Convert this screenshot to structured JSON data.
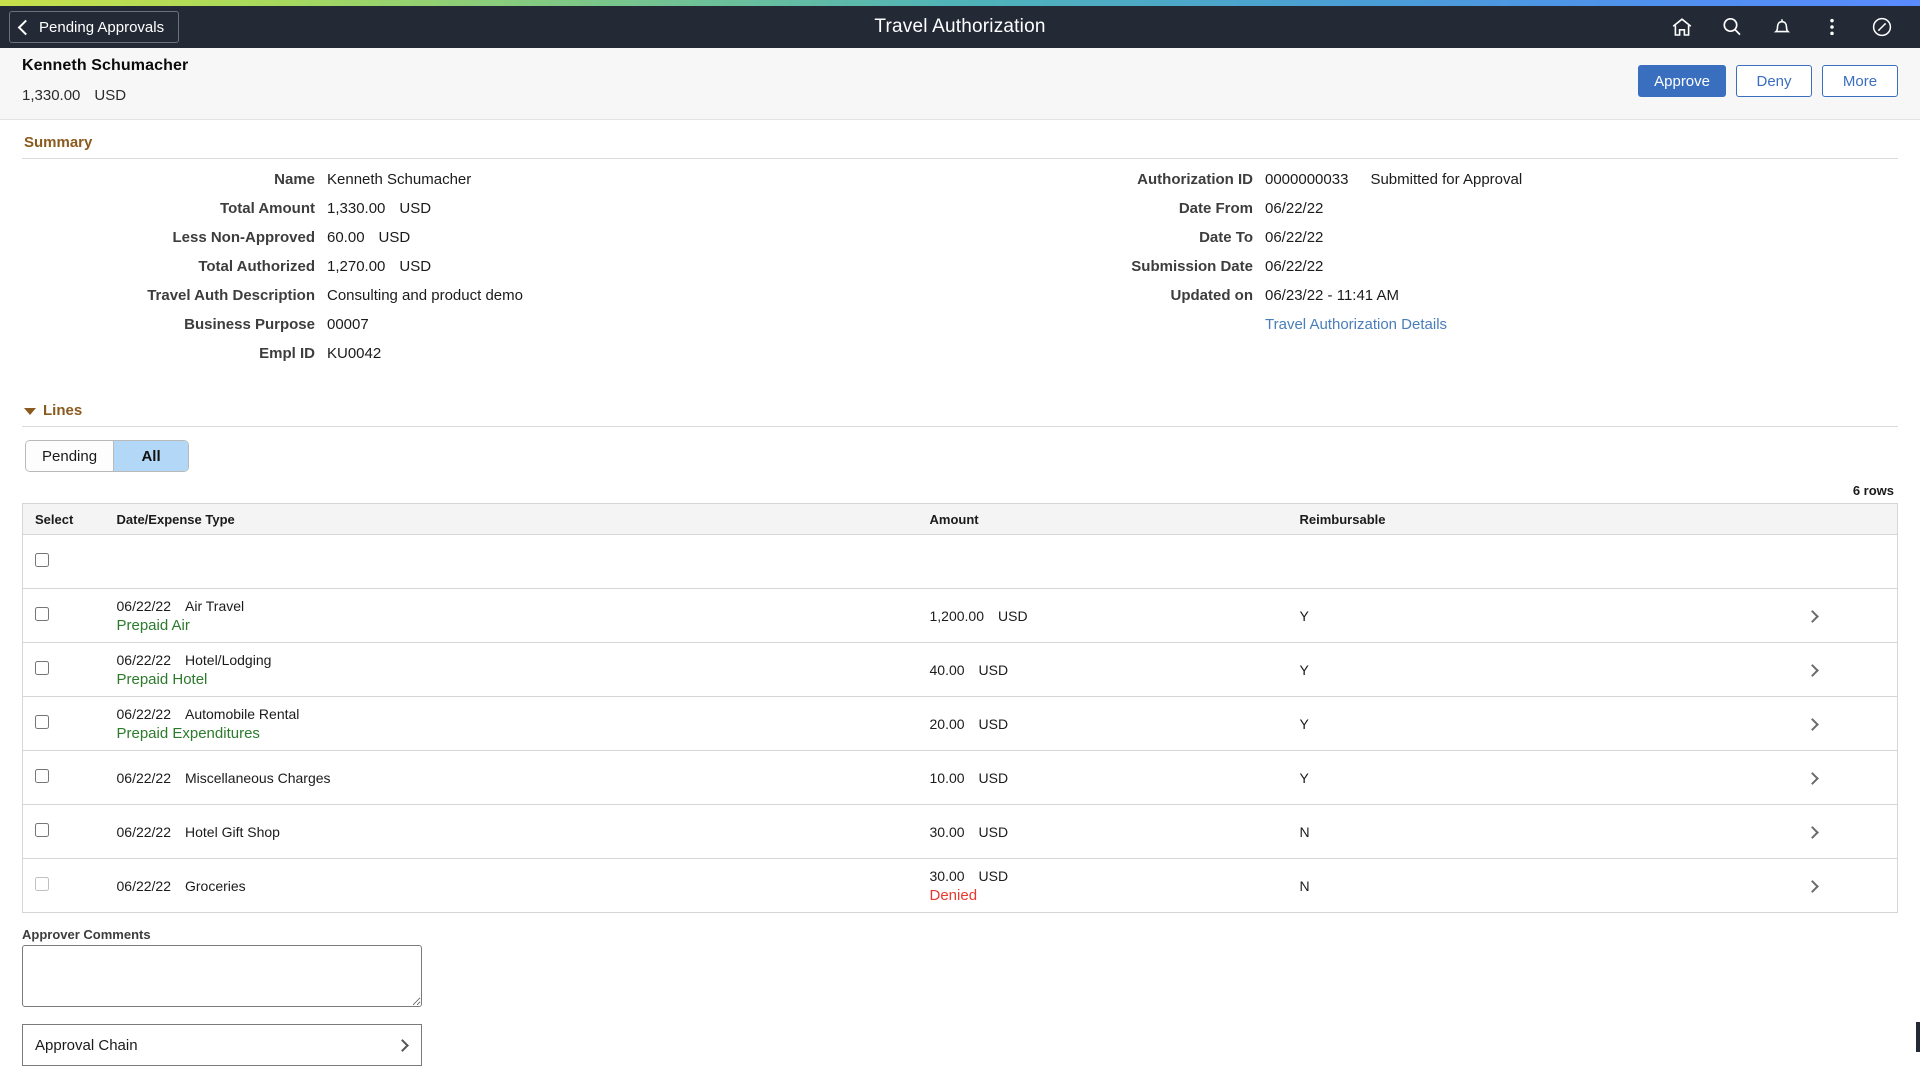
{
  "header": {
    "back_label": "Pending Approvals",
    "title": "Travel Authorization",
    "icons": [
      "home-icon",
      "search-icon",
      "notification-bell-icon",
      "overflow-menu-icon",
      "nav-bar-icon"
    ]
  },
  "subheader": {
    "employee_name": "Kenneth Schumacher",
    "amount": "1,330.00",
    "currency": "USD",
    "actions": {
      "approve": "Approve",
      "deny": "Deny",
      "more": "More"
    }
  },
  "summary": {
    "title": "Summary",
    "left": [
      {
        "label": "Name",
        "value": "Kenneth Schumacher",
        "unit": ""
      },
      {
        "label": "Total Amount",
        "value": "1,330.00",
        "unit": "USD"
      },
      {
        "label": "Less Non-Approved",
        "value": "60.00",
        "unit": "USD"
      },
      {
        "label": "Total Authorized",
        "value": "1,270.00",
        "unit": "USD"
      },
      {
        "label": "Travel Auth Description",
        "value": "Consulting and product demo",
        "unit": ""
      },
      {
        "label": "Business Purpose",
        "value": "00007",
        "unit": ""
      },
      {
        "label": "Empl ID",
        "value": "KU0042",
        "unit": ""
      }
    ],
    "right": [
      {
        "label": "Authorization ID",
        "value": "0000000033",
        "status": "Submitted for Approval"
      },
      {
        "label": "Date From",
        "value": "06/22/22",
        "status": ""
      },
      {
        "label": "Date To",
        "value": "06/22/22",
        "status": ""
      },
      {
        "label": "Submission Date",
        "value": "06/22/22",
        "status": ""
      },
      {
        "label": "Updated on",
        "value": "06/23/22 - 11:41 AM",
        "status": ""
      }
    ],
    "details_link": "Travel Authorization Details"
  },
  "lines": {
    "title": "Lines",
    "tabs": [
      {
        "label": "Pending",
        "active": false
      },
      {
        "label": "All",
        "active": true
      }
    ],
    "row_count_label": "6 rows",
    "columns": [
      "Select",
      "Date/Expense Type",
      "Amount",
      "Reimbursable"
    ],
    "rows": [
      {
        "date": "06/22/22",
        "type": "Air Travel",
        "sub": "Prepaid Air",
        "sub_state": "prepaid",
        "amount": "1,200.00",
        "currency": "USD",
        "reimbursable": "Y",
        "checked": false,
        "disabled": false
      },
      {
        "date": "06/22/22",
        "type": "Hotel/Lodging",
        "sub": "Prepaid Hotel",
        "sub_state": "prepaid",
        "amount": "40.00",
        "currency": "USD",
        "reimbursable": "Y",
        "checked": false,
        "disabled": false
      },
      {
        "date": "06/22/22",
        "type": "Automobile Rental",
        "sub": "Prepaid Expenditures",
        "sub_state": "prepaid",
        "amount": "20.00",
        "currency": "USD",
        "reimbursable": "Y",
        "checked": false,
        "disabled": false
      },
      {
        "date": "06/22/22",
        "type": "Miscellaneous Charges",
        "sub": "",
        "sub_state": "",
        "amount": "10.00",
        "currency": "USD",
        "reimbursable": "Y",
        "checked": false,
        "disabled": false
      },
      {
        "date": "06/22/22",
        "type": "Hotel Gift Shop",
        "sub": "",
        "sub_state": "",
        "amount": "30.00",
        "currency": "USD",
        "reimbursable": "N",
        "checked": false,
        "disabled": false
      },
      {
        "date": "06/22/22",
        "type": "Groceries",
        "sub": "Denied",
        "sub_state": "denied",
        "amount": "30.00",
        "currency": "USD",
        "reimbursable": "N",
        "checked": false,
        "disabled": true
      }
    ]
  },
  "footer": {
    "comments_label": "Approver Comments",
    "comments_value": "",
    "comments_placeholder": "",
    "approval_chain_label": "Approval Chain"
  },
  "colors": {
    "accent_blue": "#3a6fbf",
    "section_brown": "#8a5a1e",
    "prepaid_green": "#2c7a2c",
    "denied_red": "#e8392f",
    "header_dark": "#232a35",
    "tab_active": "#b3d7f7"
  }
}
